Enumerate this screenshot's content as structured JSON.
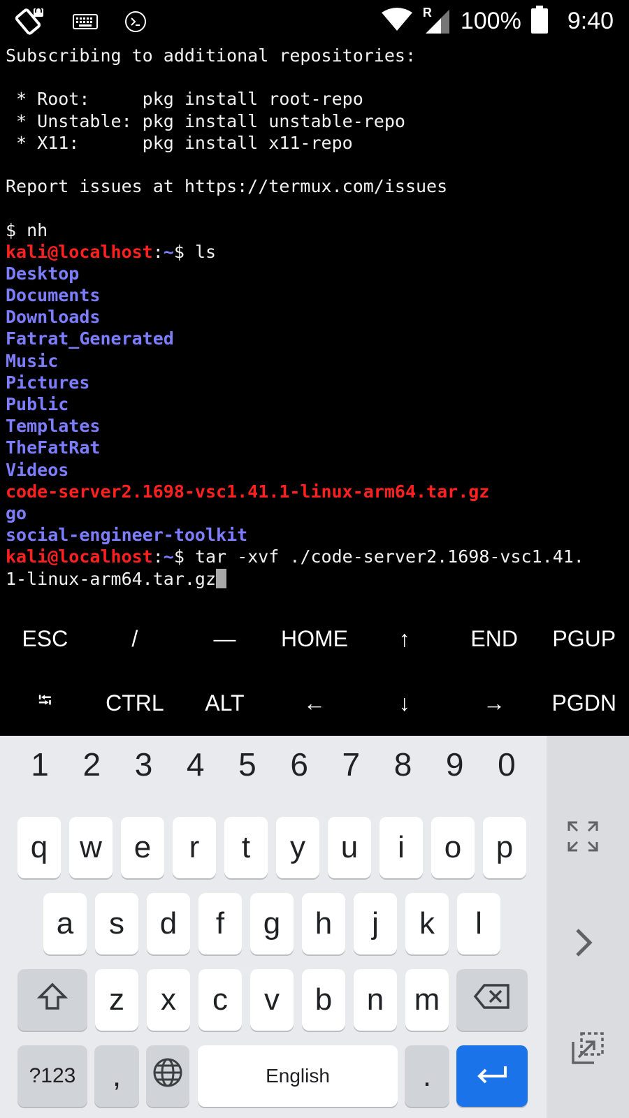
{
  "status_bar": {
    "battery_percent": "100%",
    "time": "9:40",
    "roaming_indicator": "R",
    "icons": [
      "screen-rotate-icon",
      "keyboard-icon",
      "terminal-icon",
      "wifi-icon",
      "signal-icon",
      "battery-icon"
    ]
  },
  "terminal": {
    "lines": [
      [
        {
          "t": "Subscribing to additional repositories:",
          "c": "white"
        }
      ],
      [
        {
          "t": "",
          "c": "white"
        }
      ],
      [
        {
          "t": " * Root:     pkg install root-repo",
          "c": "white"
        }
      ],
      [
        {
          "t": " * Unstable: pkg install unstable-repo",
          "c": "white"
        }
      ],
      [
        {
          "t": " * X11:      pkg install x11-repo",
          "c": "white"
        }
      ],
      [
        {
          "t": "",
          "c": "white"
        }
      ],
      [
        {
          "t": "Report issues at https://termux.com/issues",
          "c": "white"
        }
      ],
      [
        {
          "t": "",
          "c": "white"
        }
      ],
      [
        {
          "t": "$ nh",
          "c": "white"
        }
      ],
      [
        {
          "t": "kali@localhost",
          "c": "red"
        },
        {
          "t": ":",
          "c": "white"
        },
        {
          "t": "~",
          "c": "blue"
        },
        {
          "t": "$ ls",
          "c": "white"
        }
      ],
      [
        {
          "t": "Desktop",
          "c": "blue"
        }
      ],
      [
        {
          "t": "Documents",
          "c": "blue"
        }
      ],
      [
        {
          "t": "Downloads",
          "c": "blue"
        }
      ],
      [
        {
          "t": "Fatrat_Generated",
          "c": "blue"
        }
      ],
      [
        {
          "t": "Music",
          "c": "blue"
        }
      ],
      [
        {
          "t": "Pictures",
          "c": "blue"
        }
      ],
      [
        {
          "t": "Public",
          "c": "blue"
        }
      ],
      [
        {
          "t": "Templates",
          "c": "blue"
        }
      ],
      [
        {
          "t": "TheFatRat",
          "c": "blue"
        }
      ],
      [
        {
          "t": "Videos",
          "c": "blue"
        }
      ],
      [
        {
          "t": "code-server2.1698-vsc1.41.1-linux-arm64.tar.gz",
          "c": "red"
        }
      ],
      [
        {
          "t": "go",
          "c": "blue"
        }
      ],
      [
        {
          "t": "social-engineer-toolkit",
          "c": "blue"
        }
      ],
      [
        {
          "t": "kali@localhost",
          "c": "red"
        },
        {
          "t": ":",
          "c": "white"
        },
        {
          "t": "~",
          "c": "blue"
        },
        {
          "t": "$ tar -xvf ./code-server2.1698-vsc1.41.",
          "c": "white"
        }
      ],
      [
        {
          "t": "1-linux-arm64.tar.gz",
          "c": "white"
        }
      ]
    ]
  },
  "extra_keys": {
    "row1": [
      "ESC",
      "/",
      "—",
      "HOME",
      "↑",
      "END",
      "PGUP"
    ],
    "row2": [
      "⭾",
      "CTRL",
      "ALT",
      "←",
      "↓",
      "→",
      "PGDN"
    ]
  },
  "keyboard": {
    "numbers": [
      "1",
      "2",
      "3",
      "4",
      "5",
      "6",
      "7",
      "8",
      "9",
      "0"
    ],
    "row1": [
      "q",
      "w",
      "e",
      "r",
      "t",
      "y",
      "u",
      "i",
      "o",
      "p"
    ],
    "row2": [
      "a",
      "s",
      "d",
      "f",
      "g",
      "h",
      "j",
      "k",
      "l"
    ],
    "row3": [
      "z",
      "x",
      "c",
      "v",
      "b",
      "n",
      "m"
    ],
    "symbols_label": "?123",
    "comma": ",",
    "space_label": "English",
    "period": ".",
    "enter_color": "#1a73e8"
  }
}
